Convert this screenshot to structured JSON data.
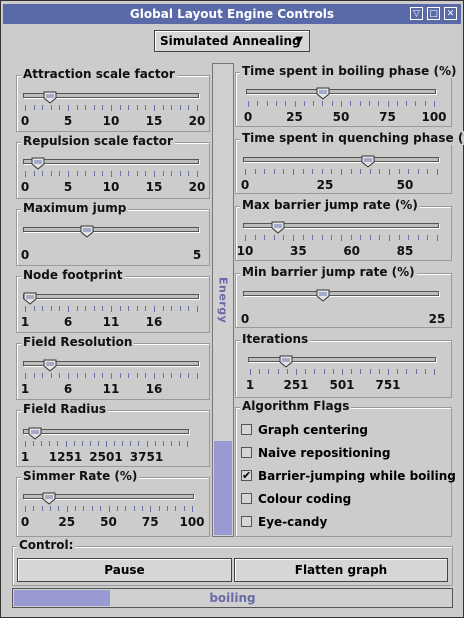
{
  "window": {
    "title": "Global Layout Engine Controls",
    "btn_menu": "▽",
    "btn_min": "□",
    "btn_close": "✕"
  },
  "algorithm_select": {
    "value": "Simulated Annealing",
    "arrow": "▼"
  },
  "sliders_left": [
    {
      "label": "Attraction scale factor",
      "ticks": [
        "0",
        "5",
        "10",
        "15",
        "20"
      ],
      "value": 2.5,
      "min": 0,
      "max": 20
    },
    {
      "label": "Repulsion scale factor",
      "ticks": [
        "0",
        "5",
        "10",
        "15",
        "20"
      ],
      "value": 1,
      "min": 0,
      "max": 20
    },
    {
      "label": "Maximum jump",
      "ticks": [
        "0",
        "5"
      ],
      "value": 1.75,
      "min": 0,
      "max": 5
    },
    {
      "label": "Node footprint",
      "ticks": [
        "1",
        "6",
        "11",
        "16"
      ],
      "value": 1,
      "min": 1,
      "max": 21
    },
    {
      "label": "Field Resolution",
      "ticks": [
        "1",
        "6",
        "11",
        "16"
      ],
      "value": 3.5,
      "min": 1,
      "max": 21
    },
    {
      "label": "Field Radius",
      "ticks": [
        "1",
        "1251",
        "2501",
        "3751"
      ],
      "value": 150,
      "min": 1,
      "max": 5001
    },
    {
      "label": "Simmer Rate (%)",
      "ticks": [
        "0",
        "25",
        "50",
        "75",
        "100"
      ],
      "value": 12,
      "min": 0,
      "max": 100
    }
  ],
  "sliders_right": [
    {
      "label": "Time spent in boiling phase (%)",
      "ticks": [
        "0",
        "25",
        "50",
        "75",
        "100"
      ],
      "value": 40,
      "min": 0,
      "max": 100
    },
    {
      "label": "Time spent in quenching phase (%)",
      "ticks": [
        "0",
        "25",
        "50"
      ],
      "value": 39,
      "min": 0,
      "max": 60
    },
    {
      "label": "Max barrier jump rate (%)",
      "ticks": [
        "10",
        "35",
        "60",
        "85"
      ],
      "value": 24,
      "min": 10,
      "max": 100
    },
    {
      "label": "Min barrier jump rate (%)",
      "ticks": [
        "0",
        "25"
      ],
      "value": 10,
      "min": 0,
      "max": 25
    },
    {
      "label": "Iterations",
      "ticks": [
        "1",
        "251",
        "501",
        "751"
      ],
      "value": 180,
      "min": 1,
      "max": 1001
    }
  ],
  "energy": {
    "label": "Energy",
    "level": 0.2
  },
  "flags": {
    "title": "Algorithm Flags",
    "items": [
      {
        "label": "Graph centering",
        "mark": ""
      },
      {
        "label": "Naive repositioning",
        "mark": ""
      },
      {
        "label": "Barrier-jumping while boiling",
        "mark": "✔"
      },
      {
        "label": "Colour coding",
        "mark": ""
      },
      {
        "label": "Eye-candy",
        "mark": ""
      }
    ]
  },
  "control": {
    "title": "Control:",
    "pause_label": "Pause",
    "flatten_label": "Flatten graph"
  },
  "status": {
    "text": "boiling",
    "progress": 0.22
  },
  "colors": {
    "title_bg": "#5a6aa8",
    "accent": "#9a9ad2",
    "tick": "#6670a8"
  }
}
